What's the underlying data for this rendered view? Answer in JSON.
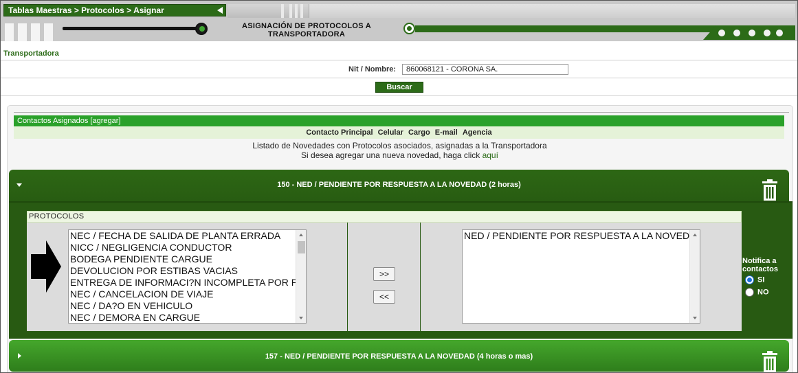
{
  "breadcrumb": "Tablas Maestras > Protocolos > Asignar",
  "page_title_line1": "ASIGNACIÓN DE PROTOCOLOS A",
  "page_title_line2": "TRANSPORTADORA",
  "section_label": "Transportadora",
  "search": {
    "label": "Nit / Nombre:",
    "value": "860068121 - CORONA SA.",
    "button": "Buscar"
  },
  "contacts": {
    "bar_label": "Contactos Asignados [agregar]",
    "headers": [
      "Contacto Principal",
      "Celular",
      "Cargo",
      "E-mail",
      "Agencia"
    ]
  },
  "info": {
    "line1": "Listado de Novedades con Protocolos asociados, asignadas a la Transportadora",
    "line2_prefix": "Si desea agregar una nueva novedad, haga click",
    "line2_link": "aquí"
  },
  "novedades": [
    {
      "title": "150 - NED / PENDIENTE POR RESPUESTA A LA NOVEDAD (2 horas)",
      "protocols_header": "PROTOCOLOS",
      "available": [
        "NEC / FECHA DE SALIDA DE PLANTA ERRADA",
        "NICC / NEGLIGENCIA CONDUCTOR",
        "BODEGA PENDIENTE CARGUE",
        "DEVOLUCION POR ESTIBAS VACIAS",
        "ENTREGA DE INFORMACI?N INCOMPLETA POR PAR",
        "NEC / CANCELACION DE VIAJE",
        "NEC / DA?O EN VEHICULO",
        "NEC / DEMORA EN CARGUE"
      ],
      "assigned": [
        "NED / PENDIENTE POR RESPUESTA A LA NOVEDAD"
      ],
      "add_button": ">>",
      "remove_button": "<<",
      "notify_label_1": "Notifica a",
      "notify_label_2": "contactos",
      "notify_yes": "SI",
      "notify_no": "NO",
      "notify_selected": "SI"
    },
    {
      "title": "157 - NED / PENDIENTE POR RESPUESTA A LA NOVEDAD (4 horas o mas)"
    }
  ],
  "colors": {
    "brand_green": "#2c6b18",
    "contacts_bar": "#2aa12a",
    "accordion_open": "#285a12",
    "accordion_closed": "#3c9a25"
  }
}
